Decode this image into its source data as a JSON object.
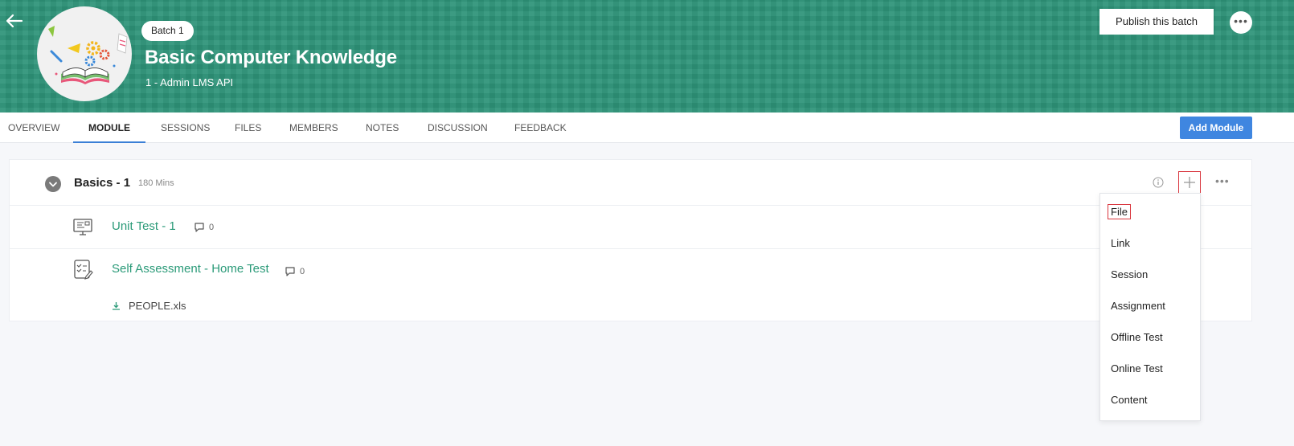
{
  "header": {
    "batch_label": "Batch 1",
    "course_title": "Basic Computer Knowledge",
    "course_subtitle": "1 - Admin LMS API",
    "publish_label": "Publish this batch",
    "more_label": "•••",
    "accent_color": "#2e9479"
  },
  "tabs": [
    {
      "label": "OVERVIEW",
      "active": false
    },
    {
      "label": "MODULE",
      "active": true
    },
    {
      "label": "SESSIONS",
      "active": false
    },
    {
      "label": "FILES",
      "active": false
    },
    {
      "label": "MEMBERS",
      "active": false
    },
    {
      "label": "NOTES",
      "active": false
    },
    {
      "label": "DISCUSSION",
      "active": false
    },
    {
      "label": "FEEDBACK",
      "active": false
    }
  ],
  "add_module_label": "Add Module",
  "module": {
    "title": "Basics - 1",
    "duration": "180 Mins",
    "more_label": "•••",
    "items": [
      {
        "icon": "monitor-icon",
        "title": "Unit Test - 1",
        "comments": "0"
      },
      {
        "icon": "checklist-icon",
        "title": "Self Assessment - Home Test",
        "comments": "0",
        "attachment": "PEOPLE.xls"
      }
    ]
  },
  "add_menu": {
    "items": [
      "File",
      "Link",
      "Session",
      "Assignment",
      "Offline Test",
      "Online Test",
      "Content"
    ]
  }
}
